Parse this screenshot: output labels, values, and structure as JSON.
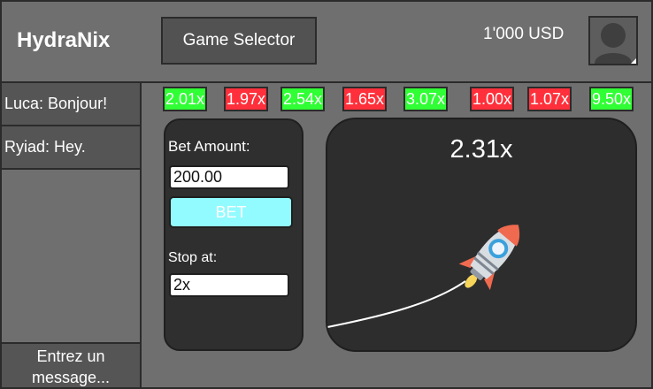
{
  "header": {
    "brand": "HydraNix",
    "game_selector_label": "Game Selector",
    "balance": "1'000 USD",
    "avatar_icon": "user-icon"
  },
  "chat": {
    "messages": [
      {
        "text": "Luca: Bonjour!"
      },
      {
        "text": "Ryiad: Hey."
      }
    ],
    "input_placeholder": "Entrez un message..."
  },
  "history": {
    "items": [
      {
        "label": "2.01x",
        "status": "win"
      },
      {
        "label": "1.97x",
        "status": "loss"
      },
      {
        "label": "2.54x",
        "status": "win"
      },
      {
        "label": "1.65x",
        "status": "loss"
      },
      {
        "label": "3.07x",
        "status": "win"
      },
      {
        "label": "1.00x",
        "status": "loss"
      },
      {
        "label": "1.07x",
        "status": "loss"
      },
      {
        "label": "9.50x",
        "status": "win"
      }
    ]
  },
  "bet_panel": {
    "bet_amount_label": "Bet Amount:",
    "bet_amount_value": "200.00",
    "bet_button_label": "BET",
    "stop_label": "Stop at:",
    "stop_value": "2x"
  },
  "game": {
    "current_multiplier": "2.31x",
    "rocket_icon": "rocket-icon"
  },
  "colors": {
    "win": "#2fff34",
    "loss": "#ff303b",
    "bet_button": "#92fbff",
    "panel_bg": "#2f2f2f"
  }
}
